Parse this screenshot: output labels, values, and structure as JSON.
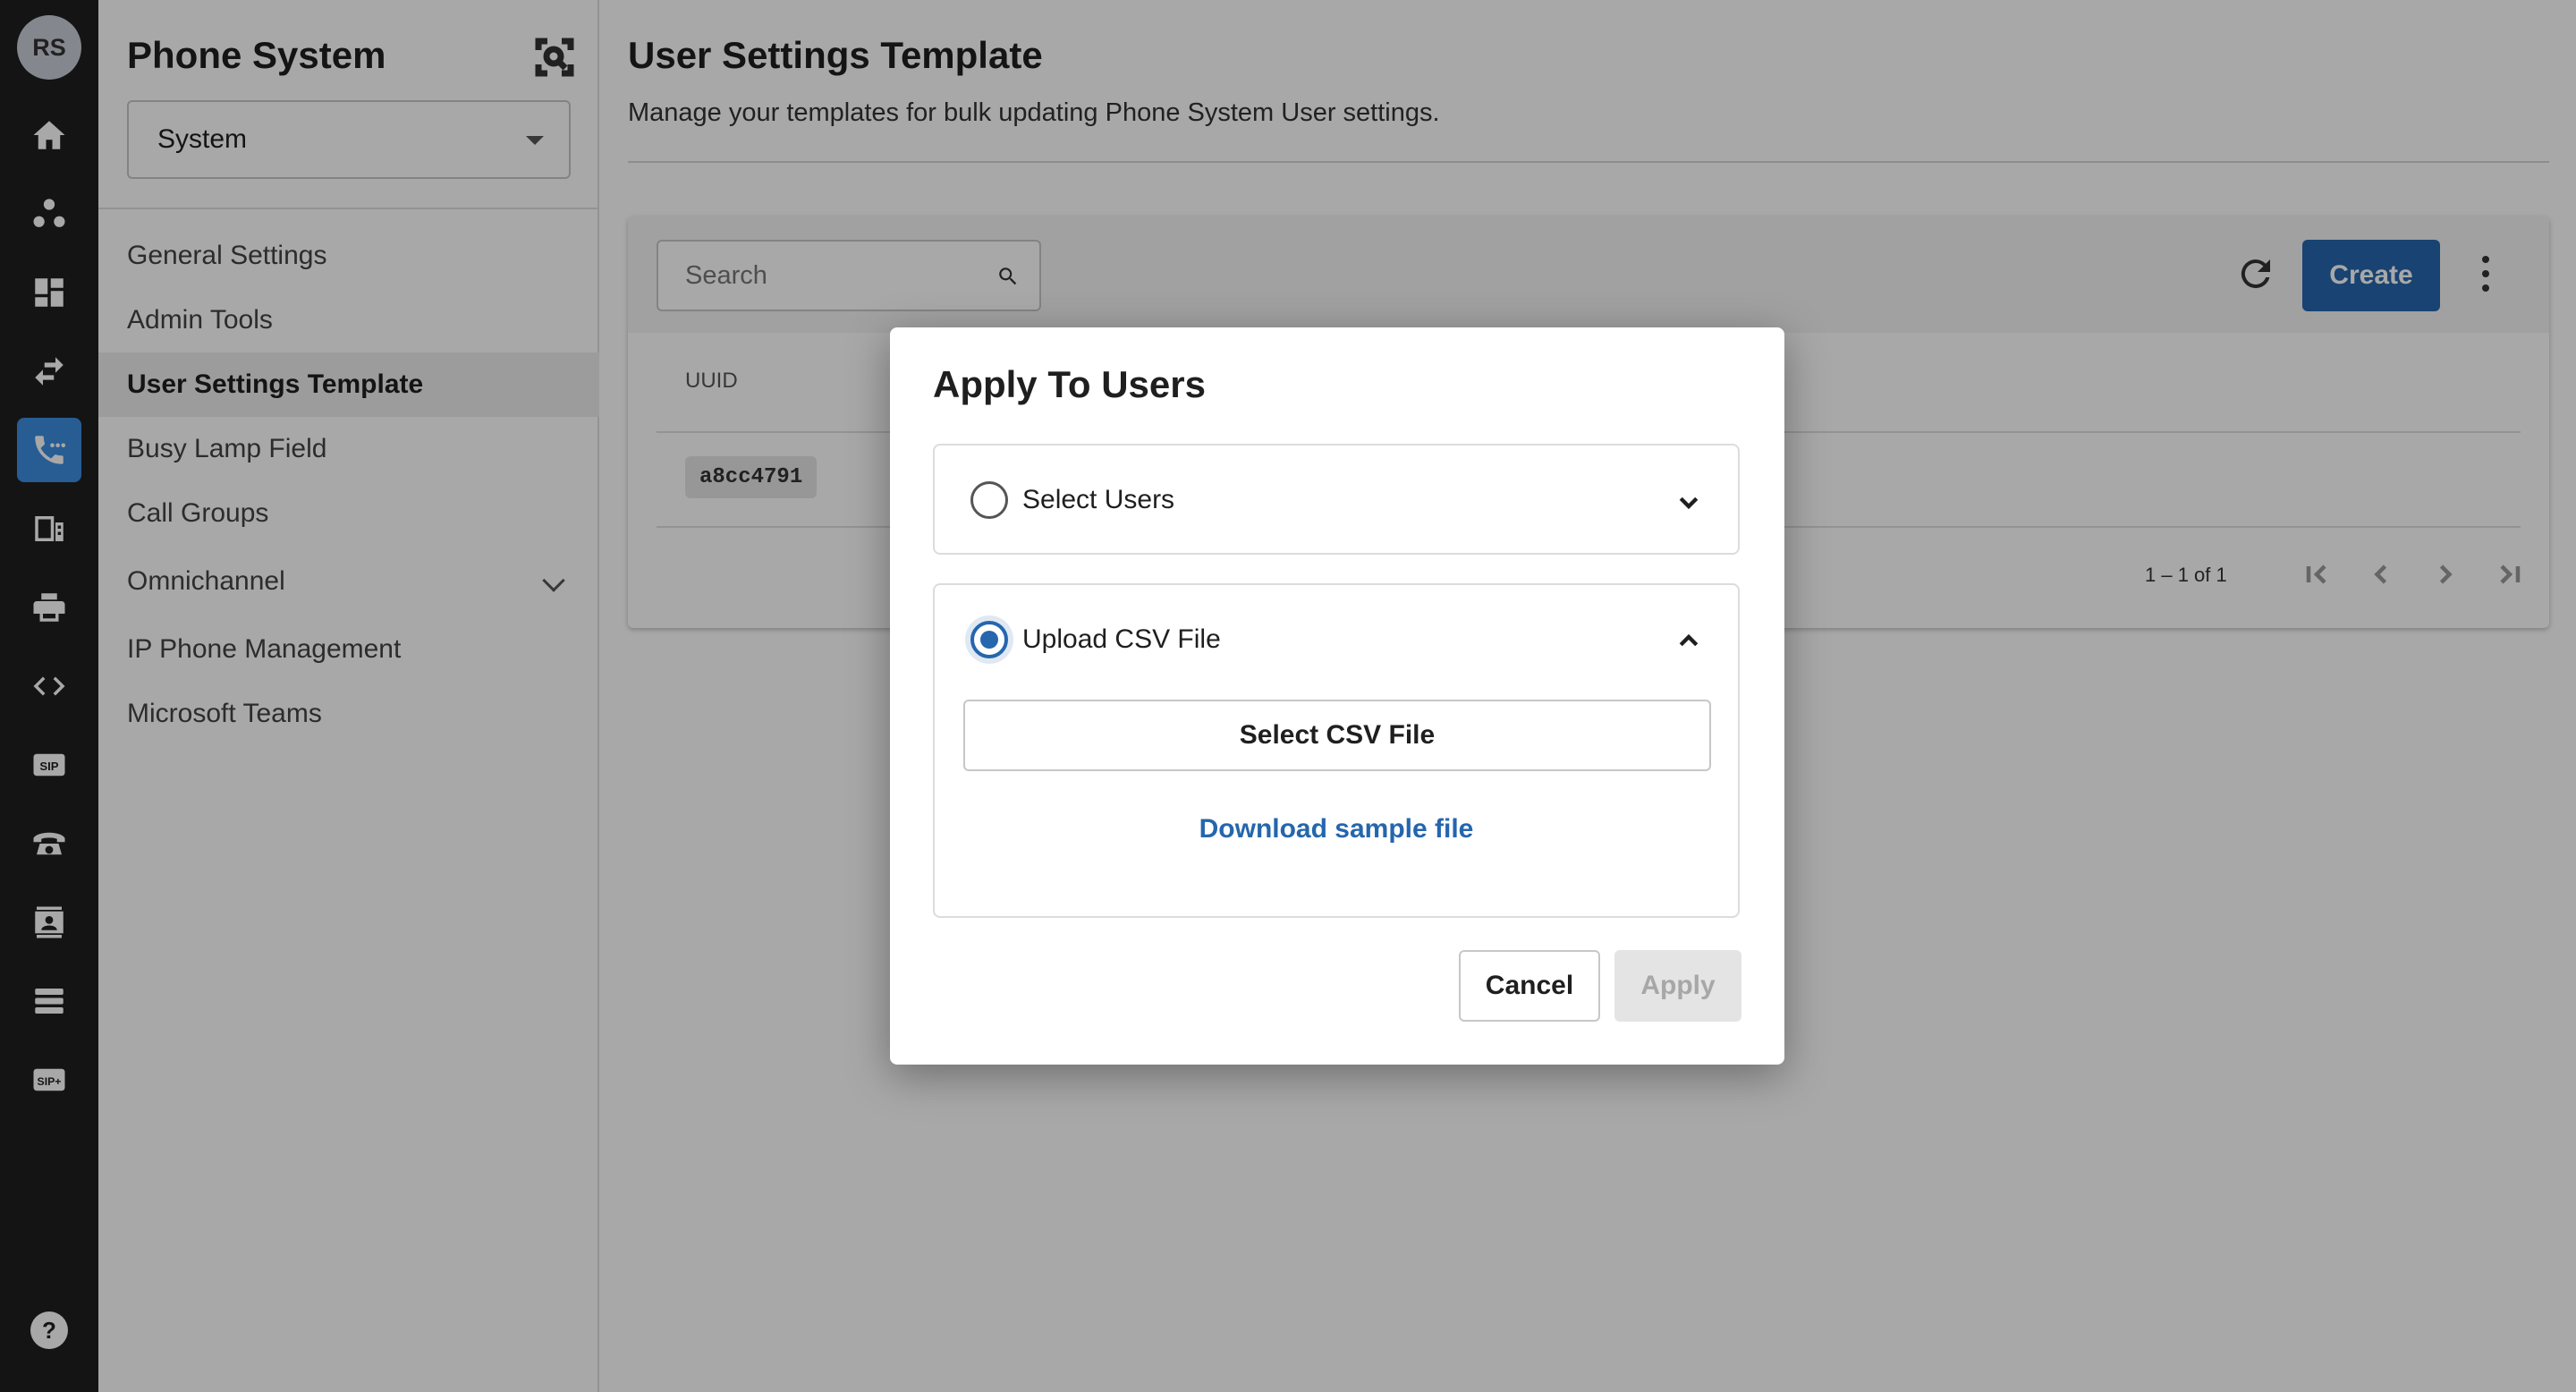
{
  "user": {
    "initials": "RS"
  },
  "rail": {
    "icons": [
      "home-icon",
      "org-icon",
      "dashboard-icon",
      "swap-icon",
      "phone-icon",
      "fax-icon",
      "printer-icon",
      "code-icon",
      "sip-icon",
      "desk-phone-icon",
      "contact-card-icon",
      "list-icon",
      "sip-plus-icon",
      "help-icon"
    ],
    "active": "phone-icon",
    "accent_color": "#3d8ee0",
    "sip_label": "SIP",
    "sip_plus_label": "SIP+",
    "help_label": "?"
  },
  "subnav": {
    "title": "Phone System",
    "select_value": "System",
    "items": [
      {
        "label": "General Settings"
      },
      {
        "label": "Admin Tools"
      },
      {
        "label": "User Settings Template",
        "active": true
      },
      {
        "label": "Busy Lamp Field"
      },
      {
        "label": "Call Groups"
      },
      {
        "label": "Omnichannel",
        "expandable": true
      },
      {
        "label": "IP Phone Management"
      },
      {
        "label": "Microsoft Teams"
      }
    ]
  },
  "main": {
    "title": "User Settings Template",
    "subtitle": "Manage your templates for bulk updating Phone System User settings.",
    "search_placeholder": "Search",
    "create_label": "Create",
    "primary_color": "#2566ad",
    "table": {
      "columns": [
        "UUID"
      ],
      "rows": [
        {
          "uuid": "a8cc4791"
        }
      ]
    },
    "pagination": "1 – 1 of 1"
  },
  "dialog": {
    "title": "Apply To Users",
    "options": [
      {
        "label": "Select Users",
        "checked": false,
        "expanded": false
      },
      {
        "label": "Upload CSV File",
        "checked": true,
        "expanded": true
      }
    ],
    "select_csv_label": "Select CSV File",
    "download_sample_label": "Download sample file",
    "cancel_label": "Cancel",
    "apply_label": "Apply",
    "apply_enabled": false
  }
}
